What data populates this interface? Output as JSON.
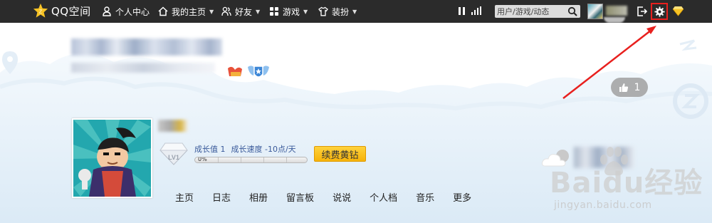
{
  "topbar": {
    "logo_text": "QQ空间",
    "nav": [
      {
        "label": "个人中心",
        "icon": "user-icon",
        "has_caret": false
      },
      {
        "label": "我的主页",
        "icon": "home-icon",
        "has_caret": true
      },
      {
        "label": "好友",
        "icon": "friends-icon",
        "has_caret": true
      },
      {
        "label": "游戏",
        "icon": "grid-icon",
        "has_caret": true
      },
      {
        "label": "装扮",
        "icon": "shirt-icon",
        "has_caret": true
      }
    ],
    "search_placeholder": "用户/游戏/动态",
    "colors": {
      "bar": "#2b2b2b",
      "highlight_box": "#e8201e"
    }
  },
  "profile": {
    "like_count": "1",
    "level_badge": "LV1",
    "growth_value": "成长值 1",
    "growth_speed": "成长速度 -10点/天",
    "progress_text": "0%",
    "progress_value": 0,
    "renew_button": "续费黄钻"
  },
  "tabs": [
    "主页",
    "日志",
    "相册",
    "留言板",
    "说说",
    "个人档",
    "音乐",
    "更多"
  ],
  "watermark": {
    "main": "Baidu经验",
    "sub": "jingyan.baidu.com"
  },
  "annotation": {
    "color": "#e8201e"
  }
}
